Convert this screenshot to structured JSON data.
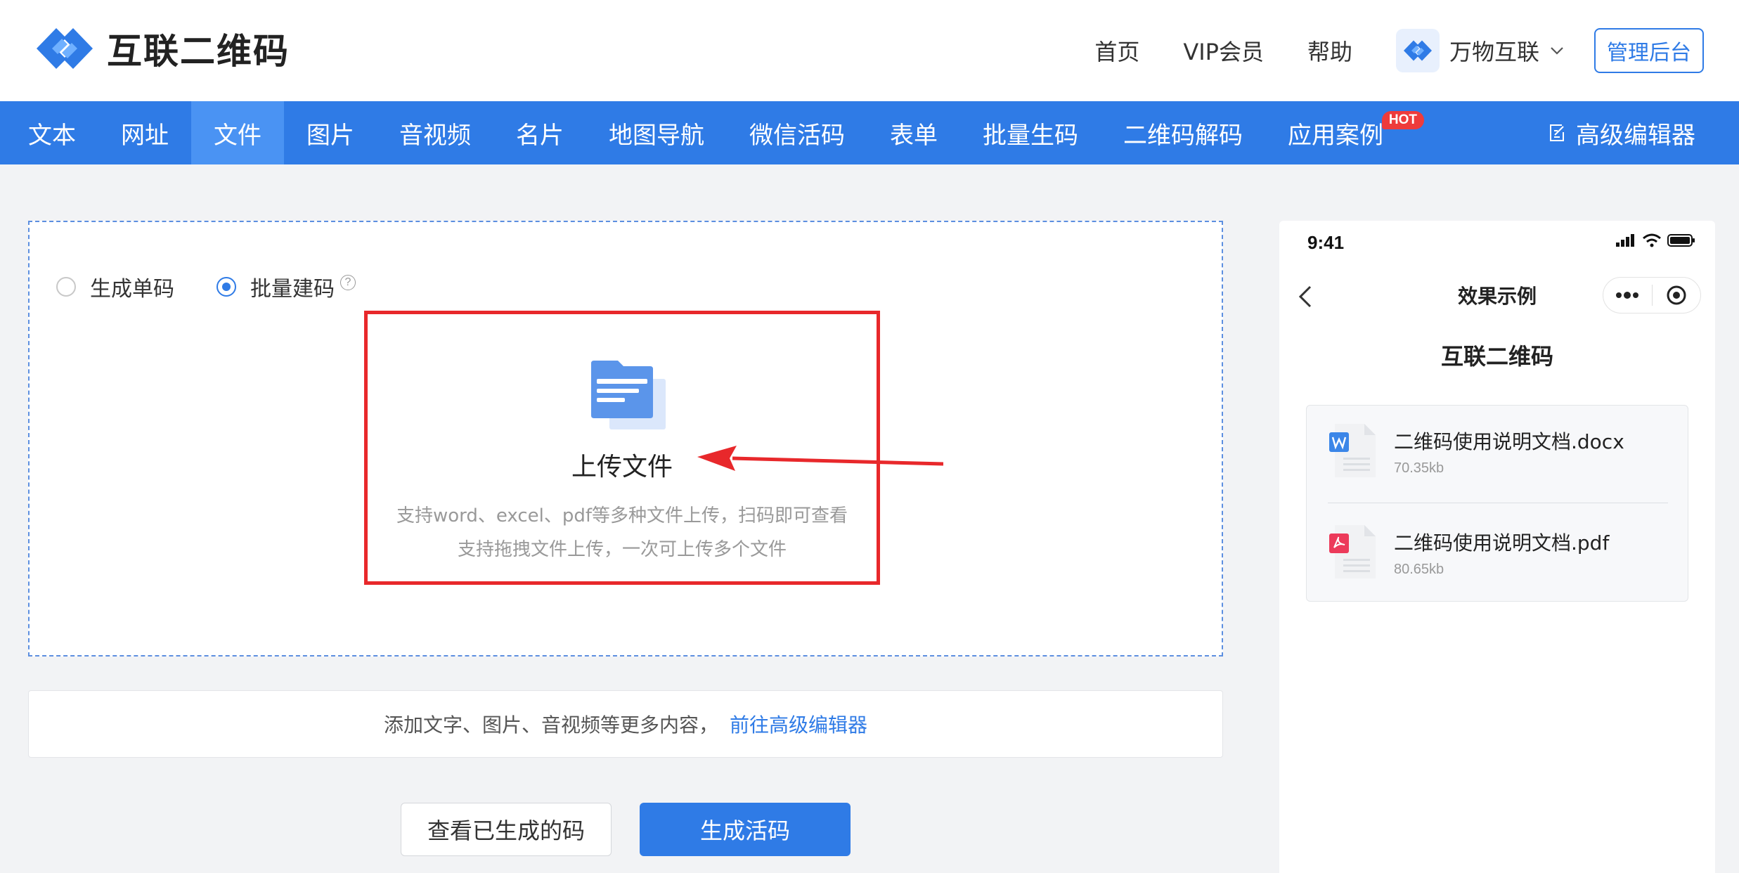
{
  "brand": {
    "name": "互联二维码",
    "accent_color": "#2f7be6"
  },
  "top_links": [
    "首页",
    "VIP会员",
    "帮助"
  ],
  "brand_switch": {
    "name": "万物互联"
  },
  "admin_label": "管理后台",
  "nav": {
    "items": [
      {
        "label": "文本",
        "active": false
      },
      {
        "label": "网址",
        "active": false
      },
      {
        "label": "文件",
        "active": true
      },
      {
        "label": "图片",
        "active": false
      },
      {
        "label": "音视频",
        "active": false
      },
      {
        "label": "名片",
        "active": false
      },
      {
        "label": "地图导航",
        "active": false
      },
      {
        "label": "微信活码",
        "active": false
      },
      {
        "label": "表单",
        "active": false
      },
      {
        "label": "批量生码",
        "active": false
      },
      {
        "label": "二维码解码",
        "active": false
      },
      {
        "label": "应用案例",
        "active": false,
        "badge": "HOT"
      }
    ],
    "editor_label": "高级编辑器"
  },
  "modes": {
    "single": "生成单码",
    "batch": "批量建码",
    "help": "?",
    "selected": "batch"
  },
  "upload": {
    "title": "上传文件",
    "desc_line1": "支持word、excel、pdf等多种文件上传，扫码即可查看",
    "desc_line2": "支持拖拽文件上传，一次可上传多个文件"
  },
  "hint": {
    "text": "添加文字、图片、音视频等更多内容，",
    "link": "前往高级编辑器"
  },
  "buttons": {
    "view": "查看已生成的码",
    "generate": "生成活码"
  },
  "preview": {
    "time": "9:41",
    "nav_title": "效果示例",
    "sub_title": "互联二维码",
    "files": [
      {
        "name": "二维码使用说明文档.docx",
        "size": "70.35kb",
        "type": "word-icon",
        "color": "#3b86e8"
      },
      {
        "name": "二维码使用说明文档.pdf",
        "size": "80.65kb",
        "type": "pdf-icon",
        "color": "#ec3a5a"
      }
    ]
  }
}
